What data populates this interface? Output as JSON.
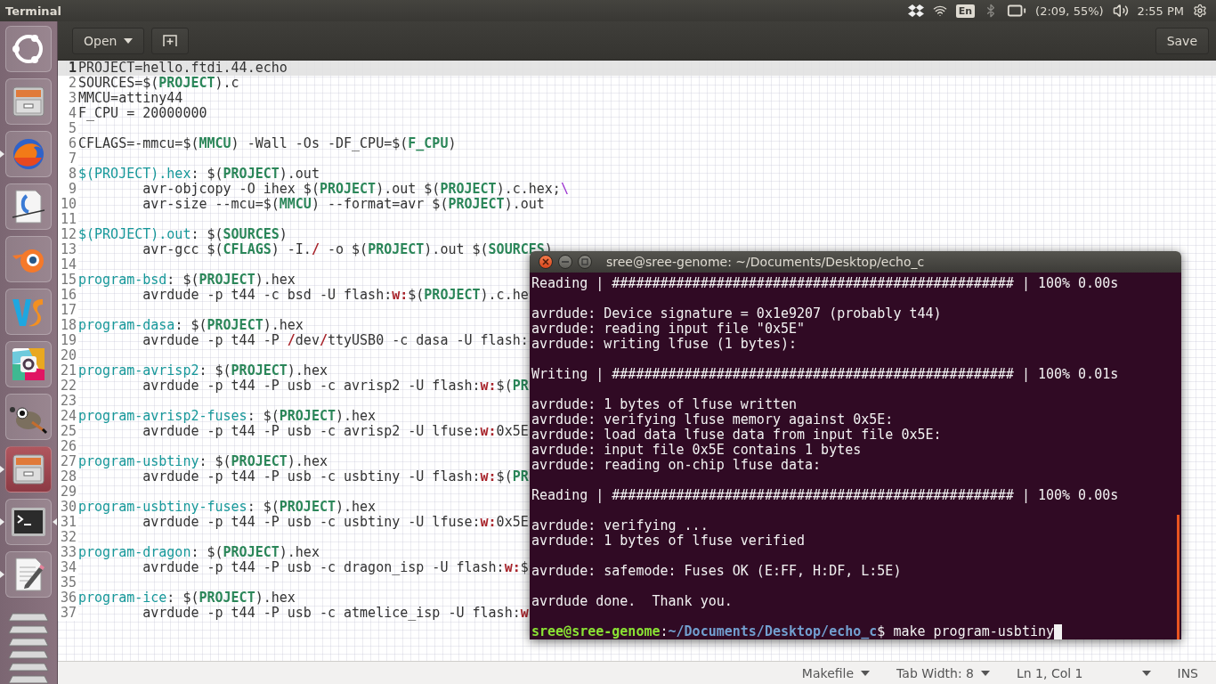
{
  "top_panel": {
    "title": "Terminal",
    "indicators": [
      {
        "kind": "dropbox"
      },
      {
        "kind": "wifi"
      },
      {
        "kind": "keyboard",
        "text": "En"
      },
      {
        "kind": "bluetooth"
      },
      {
        "kind": "battery",
        "text": "(2:09, 55%)"
      },
      {
        "kind": "volume"
      },
      {
        "kind": "clock",
        "text": "2:55 PM"
      },
      {
        "kind": "session"
      }
    ]
  },
  "launcher": [
    {
      "kind": "dash",
      "running": false,
      "focused": false,
      "highlighted": false
    },
    {
      "kind": "files",
      "running": false,
      "focused": false,
      "highlighted": false
    },
    {
      "kind": "browser",
      "running": true,
      "focused": false,
      "highlighted": false
    },
    {
      "kind": "office",
      "running": false,
      "focused": false,
      "highlighted": false
    },
    {
      "kind": "blender",
      "running": false,
      "focused": false,
      "highlighted": false
    },
    {
      "kind": "ide",
      "running": false,
      "focused": false,
      "highlighted": false
    },
    {
      "kind": "chat",
      "running": false,
      "focused": false,
      "highlighted": false
    },
    {
      "kind": "gimp",
      "running": false,
      "focused": false,
      "highlighted": false
    },
    {
      "kind": "files",
      "running": true,
      "focused": false,
      "highlighted": true
    },
    {
      "kind": "terminal",
      "running": true,
      "focused": true,
      "highlighted": false
    },
    {
      "kind": "editor",
      "running": true,
      "focused": false,
      "highlighted": false
    },
    {
      "kind": "stack",
      "running": false,
      "focused": false,
      "highlighted": false
    }
  ],
  "editor": {
    "toolbar": {
      "open": "Open",
      "save": "Save"
    },
    "lines": [
      {
        "n": "1",
        "current": true,
        "segs": [
          {
            "kind": "plain",
            "t": "PROJECT=hello.ftdi.44.echo"
          }
        ]
      },
      {
        "n": "2",
        "current": false,
        "segs": [
          {
            "kind": "plain",
            "t": "SOURCES=$("
          },
          {
            "kind": "var",
            "t": "PROJECT"
          },
          {
            "kind": "plain",
            "t": ").c"
          }
        ]
      },
      {
        "n": "3",
        "current": false,
        "segs": [
          {
            "kind": "plain",
            "t": "MMCU=attiny44"
          }
        ]
      },
      {
        "n": "4",
        "current": false,
        "segs": [
          {
            "kind": "plain",
            "t": "F_CPU = 20000000"
          }
        ]
      },
      {
        "n": "5",
        "current": false
      },
      {
        "n": "6",
        "current": false,
        "segs": [
          {
            "kind": "plain",
            "t": "CFLAGS=-mmcu=$("
          },
          {
            "kind": "var",
            "t": "MMCU"
          },
          {
            "kind": "plain",
            "t": ") -Wall -Os -DF_CPU=$("
          },
          {
            "kind": "var",
            "t": "F_CPU"
          },
          {
            "kind": "plain",
            "t": ")"
          }
        ]
      },
      {
        "n": "7",
        "current": false
      },
      {
        "n": "8",
        "current": false,
        "segs": [
          {
            "kind": "target",
            "t": "$(PROJECT).hex"
          },
          {
            "kind": "plain",
            "t": ": $("
          },
          {
            "kind": "var",
            "t": "PROJECT"
          },
          {
            "kind": "plain",
            "t": ").out"
          }
        ]
      },
      {
        "n": "9",
        "current": false,
        "segs": [
          {
            "kind": "plain",
            "t": "\tavr-objcopy -O ihex $("
          },
          {
            "kind": "var",
            "t": "PROJECT"
          },
          {
            "kind": "plain",
            "t": ").out $("
          },
          {
            "kind": "var",
            "t": "PROJECT"
          },
          {
            "kind": "plain",
            "t": ").c.hex;"
          },
          {
            "kind": "escape",
            "t": "\\"
          }
        ]
      },
      {
        "n": "10",
        "current": false,
        "segs": [
          {
            "kind": "plain",
            "t": "\tavr-size --mcu=$("
          },
          {
            "kind": "var",
            "t": "MMCU"
          },
          {
            "kind": "plain",
            "t": ") --format=avr $("
          },
          {
            "kind": "var",
            "t": "PROJECT"
          },
          {
            "kind": "plain",
            "t": ").out"
          }
        ]
      },
      {
        "n": "11",
        "current": false
      },
      {
        "n": "12",
        "current": false,
        "segs": [
          {
            "kind": "target",
            "t": "$(PROJECT).out"
          },
          {
            "kind": "plain",
            "t": ": $("
          },
          {
            "kind": "var",
            "t": "SOURCES"
          },
          {
            "kind": "plain",
            "t": ")"
          }
        ]
      },
      {
        "n": "13",
        "current": false,
        "segs": [
          {
            "kind": "plain",
            "t": "\tavr-gcc $("
          },
          {
            "kind": "var",
            "t": "CFLAGS"
          },
          {
            "kind": "plain",
            "t": ") -I."
          },
          {
            "kind": "special",
            "t": "/"
          },
          {
            "kind": "plain",
            "t": " -o $("
          },
          {
            "kind": "var",
            "t": "PROJECT"
          },
          {
            "kind": "plain",
            "t": ").out $("
          },
          {
            "kind": "var",
            "t": "SOURCES"
          },
          {
            "kind": "plain",
            "t": ")"
          }
        ]
      },
      {
        "n": "14",
        "current": false
      },
      {
        "n": "15",
        "current": false,
        "segs": [
          {
            "kind": "target",
            "t": "program-bsd"
          },
          {
            "kind": "plain",
            "t": ": $("
          },
          {
            "kind": "var",
            "t": "PROJECT"
          },
          {
            "kind": "plain",
            "t": ").hex"
          }
        ]
      },
      {
        "n": "16",
        "current": false,
        "segs": [
          {
            "kind": "plain",
            "t": "\tavrdude -p t44 -c bsd -U flash:"
          },
          {
            "kind": "special",
            "t": "w:"
          },
          {
            "kind": "plain",
            "t": "$("
          },
          {
            "kind": "var",
            "t": "PROJECT"
          },
          {
            "kind": "plain",
            "t": ").c.he"
          }
        ]
      },
      {
        "n": "17",
        "current": false
      },
      {
        "n": "18",
        "current": false,
        "segs": [
          {
            "kind": "target",
            "t": "program-dasa"
          },
          {
            "kind": "plain",
            "t": ": $("
          },
          {
            "kind": "var",
            "t": "PROJECT"
          },
          {
            "kind": "plain",
            "t": ").hex"
          }
        ]
      },
      {
        "n": "19",
        "current": false,
        "segs": [
          {
            "kind": "plain",
            "t": "\tavrdude -p t44 -P "
          },
          {
            "kind": "special",
            "t": "/"
          },
          {
            "kind": "plain",
            "t": "dev"
          },
          {
            "kind": "special",
            "t": "/"
          },
          {
            "kind": "plain",
            "t": "ttyUSB0 -c dasa -U flash:"
          }
        ]
      },
      {
        "n": "20",
        "current": false
      },
      {
        "n": "21",
        "current": false,
        "segs": [
          {
            "kind": "target",
            "t": "program-avrisp2"
          },
          {
            "kind": "plain",
            "t": ": $("
          },
          {
            "kind": "var",
            "t": "PROJECT"
          },
          {
            "kind": "plain",
            "t": ").hex"
          }
        ]
      },
      {
        "n": "22",
        "current": false,
        "segs": [
          {
            "kind": "plain",
            "t": "\tavrdude -p t44 -P usb -c avrisp2 -U flash:"
          },
          {
            "kind": "special",
            "t": "w:"
          },
          {
            "kind": "plain",
            "t": "$("
          },
          {
            "kind": "var",
            "t": "PR"
          }
        ]
      },
      {
        "n": "23",
        "current": false
      },
      {
        "n": "24",
        "current": false,
        "segs": [
          {
            "kind": "target",
            "t": "program-avrisp2-fuses"
          },
          {
            "kind": "plain",
            "t": ": $("
          },
          {
            "kind": "var",
            "t": "PROJECT"
          },
          {
            "kind": "plain",
            "t": ").hex"
          }
        ]
      },
      {
        "n": "25",
        "current": false,
        "segs": [
          {
            "kind": "plain",
            "t": "\tavrdude -p t44 -P usb -c avrisp2 -U lfuse:"
          },
          {
            "kind": "special",
            "t": "w:"
          },
          {
            "kind": "plain",
            "t": "0x5E"
          }
        ]
      },
      {
        "n": "26",
        "current": false
      },
      {
        "n": "27",
        "current": false,
        "segs": [
          {
            "kind": "target",
            "t": "program-usbtiny"
          },
          {
            "kind": "plain",
            "t": ": $("
          },
          {
            "kind": "var",
            "t": "PROJECT"
          },
          {
            "kind": "plain",
            "t": ").hex"
          }
        ]
      },
      {
        "n": "28",
        "current": false,
        "segs": [
          {
            "kind": "plain",
            "t": "\tavrdude -p t44 -P usb -c usbtiny -U flash:"
          },
          {
            "kind": "special",
            "t": "w:"
          },
          {
            "kind": "plain",
            "t": "$("
          },
          {
            "kind": "var",
            "t": "PR"
          }
        ]
      },
      {
        "n": "29",
        "current": false
      },
      {
        "n": "30",
        "current": false,
        "segs": [
          {
            "kind": "target",
            "t": "program-usbtiny-fuses"
          },
          {
            "kind": "plain",
            "t": ": $("
          },
          {
            "kind": "var",
            "t": "PROJECT"
          },
          {
            "kind": "plain",
            "t": ").hex"
          }
        ]
      },
      {
        "n": "31",
        "current": false,
        "segs": [
          {
            "kind": "plain",
            "t": "\tavrdude -p t44 -P usb -c usbtiny -U lfuse:"
          },
          {
            "kind": "special",
            "t": "w:"
          },
          {
            "kind": "plain",
            "t": "0x5E"
          }
        ]
      },
      {
        "n": "32",
        "current": false
      },
      {
        "n": "33",
        "current": false,
        "segs": [
          {
            "kind": "target",
            "t": "program-dragon"
          },
          {
            "kind": "plain",
            "t": ": $("
          },
          {
            "kind": "var",
            "t": "PROJECT"
          },
          {
            "kind": "plain",
            "t": ").hex"
          }
        ]
      },
      {
        "n": "34",
        "current": false,
        "segs": [
          {
            "kind": "plain",
            "t": "\tavrdude -p t44 -P usb -c dragon_isp -U flash:"
          },
          {
            "kind": "special",
            "t": "w:"
          },
          {
            "kind": "plain",
            "t": "$"
          }
        ]
      },
      {
        "n": "35",
        "current": false
      },
      {
        "n": "36",
        "current": false,
        "segs": [
          {
            "kind": "target",
            "t": "program-ice"
          },
          {
            "kind": "plain",
            "t": ": $("
          },
          {
            "kind": "var",
            "t": "PROJECT"
          },
          {
            "kind": "plain",
            "t": ").hex"
          }
        ]
      },
      {
        "n": "37",
        "current": false,
        "segs": [
          {
            "kind": "plain",
            "t": "\tavrdude -p t44 -P usb -c atmelice_isp -U flash:"
          },
          {
            "kind": "special",
            "t": "w"
          }
        ]
      }
    ],
    "status_bar": [
      {
        "kind": "dropdown",
        "text": "Makefile"
      },
      {
        "kind": "dropdown",
        "text": "Tab Width: 8"
      },
      {
        "kind": "label",
        "text": "Ln 1, Col 1"
      },
      {
        "kind": "dropdown"
      },
      {
        "kind": "label",
        "text": "INS"
      }
    ]
  },
  "terminal": {
    "title": "sree@sree-genome: ~/Documents/Desktop/echo_c",
    "blocks": [
      [
        "Reading | ################################################## | 100% 0.00s"
      ],
      [
        "avrdude: Device signature = 0x1e9207 (probably t44)",
        "avrdude: reading input file \"0x5E\"",
        "avrdude: writing lfuse (1 bytes):"
      ],
      [
        "Writing | ################################################## | 100% 0.01s"
      ],
      [
        "avrdude: 1 bytes of lfuse written",
        "avrdude: verifying lfuse memory against 0x5E:",
        "avrdude: load data lfuse data from input file 0x5E:",
        "avrdude: input file 0x5E contains 1 bytes",
        "avrdude: reading on-chip lfuse data:"
      ],
      [
        "Reading | ################################################## | 100% 0.00s"
      ],
      [
        "avrdude: verifying ...",
        "avrdude: 1 bytes of lfuse verified"
      ],
      [
        "avrdude: safemode: Fuses OK (E:FF, H:DF, L:5E)"
      ],
      [
        "avrdude done.  Thank you."
      ]
    ],
    "prompt": {
      "user_host": "sree@sree-genome",
      "separator": ":",
      "path": "~/Documents/Desktop/echo_c",
      "input": "$ make program-usbtiny"
    }
  }
}
